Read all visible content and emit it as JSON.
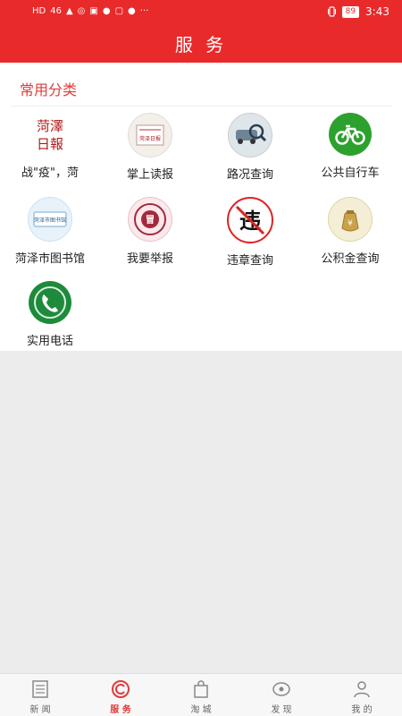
{
  "status": {
    "left_glyphs": [
      "HD",
      "46",
      "▲",
      "◎",
      "▣",
      "●",
      "▢",
      "●",
      "···"
    ],
    "battery": "89",
    "time": "3:43"
  },
  "header": {
    "title": "服 务"
  },
  "section": {
    "title": "常用分类"
  },
  "services": [
    {
      "label": "战\"疫\"，菏",
      "icon": "newspaper-logo-icon",
      "logo_text": "菏澤日報"
    },
    {
      "label": "掌上读报",
      "icon": "paper-reader-icon",
      "logo_text": "菏泽日报"
    },
    {
      "label": "路况查询",
      "icon": "traffic-search-icon"
    },
    {
      "label": "公共自行车",
      "icon": "bicycle-icon"
    },
    {
      "label": "菏泽市图书馆",
      "icon": "library-card-icon",
      "logo_text": "菏泽市图书馆"
    },
    {
      "label": "我要举报",
      "icon": "report-stamp-icon"
    },
    {
      "label": "违章查询",
      "icon": "violation-no-entry-icon",
      "logo_text": "违"
    },
    {
      "label": "公积金查询",
      "icon": "fund-bag-icon"
    },
    {
      "label": "实用电话",
      "icon": "phone-icon"
    }
  ],
  "colors": {
    "brand_red": "#e92a2a",
    "section_red": "#e23b3b",
    "bike_green": "#2da12d",
    "phone_green": "#1e8a3c"
  },
  "bottom_nav": [
    {
      "label": "新 闻",
      "icon": "news-icon",
      "active": false
    },
    {
      "label": "服 务",
      "icon": "service-icon",
      "active": true
    },
    {
      "label": "淘 城",
      "icon": "shopping-bag-icon",
      "active": false
    },
    {
      "label": "发 现",
      "icon": "discover-icon",
      "active": false
    },
    {
      "label": "我 的",
      "icon": "profile-icon",
      "active": false
    }
  ]
}
